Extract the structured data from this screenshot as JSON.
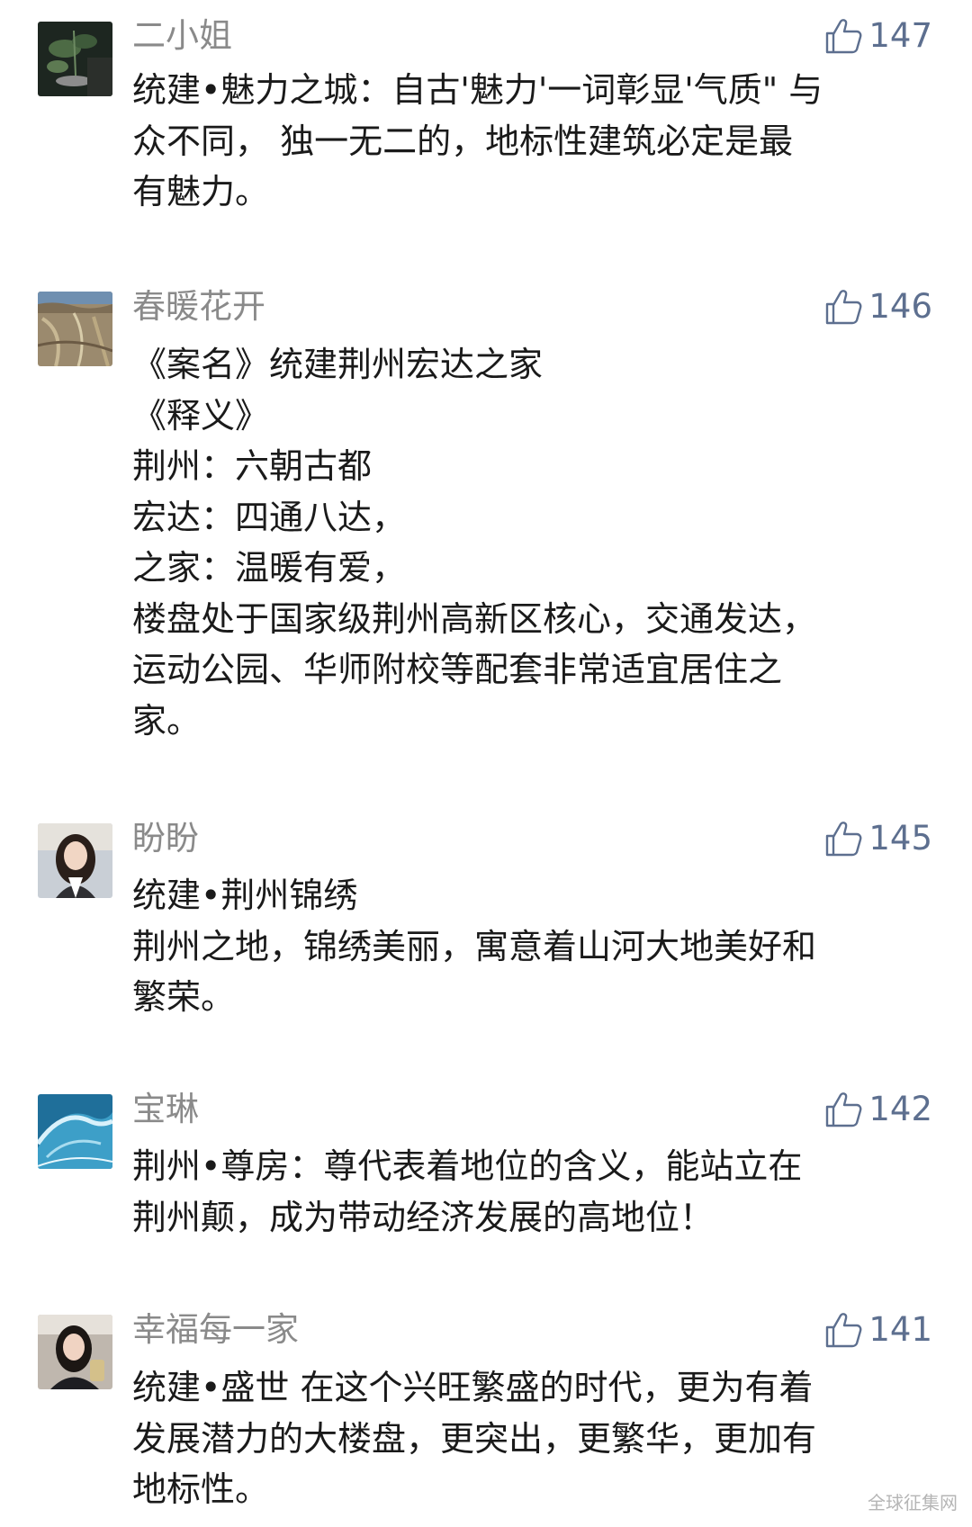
{
  "comments": [
    {
      "user": "二小姐",
      "likes": "147",
      "avatar_icon": "dark-plant-photo-avatar",
      "lines": [
        "统建•魅力之城：自古'魅力'一词彰显'气质\" 与",
        "众不同， 独一无二的，地标性建筑必定是最",
        "有魅力。"
      ]
    },
    {
      "user": "春暖花开",
      "likes": "146",
      "avatar_icon": "aerial-landscape-avatar",
      "lines": [
        "《案名》统建荆州宏达之家",
        "《释义》",
        "荆州：六朝古都",
        "宏达：四通八达，",
        "之家：温暖有爱，",
        "楼盘处于国家级荆州高新区核心，交通发达，",
        "运动公园、华师附校等配套非常适宜居住之",
        "家。"
      ]
    },
    {
      "user": "盼盼",
      "likes": "145",
      "avatar_icon": "woman-portrait-avatar",
      "lines": [
        "统建•荆州锦绣",
        "荆州之地，锦绣美丽，寓意着山河大地美好和",
        "繁荣。"
      ]
    },
    {
      "user": "宝琳",
      "likes": "142",
      "avatar_icon": "ocean-wave-avatar",
      "lines": [
        "荆州•尊房：尊代表着地位的含义，能站立在",
        "荆州颠，成为带动经济发展的高地位！"
      ]
    },
    {
      "user": "幸福每一家",
      "likes": "141",
      "avatar_icon": "woman-selfie-avatar",
      "lines": [
        "统建•盛世 在这个兴旺繁盛的时代，更为有着",
        "发展潜力的大楼盘，更突出，更繁华，更加有",
        "地标性。"
      ]
    }
  ],
  "watermark": "全球征集网",
  "colors": {
    "username": "#8a8a8a",
    "like": "#5d6f8f",
    "text": "#1a1a1a"
  }
}
